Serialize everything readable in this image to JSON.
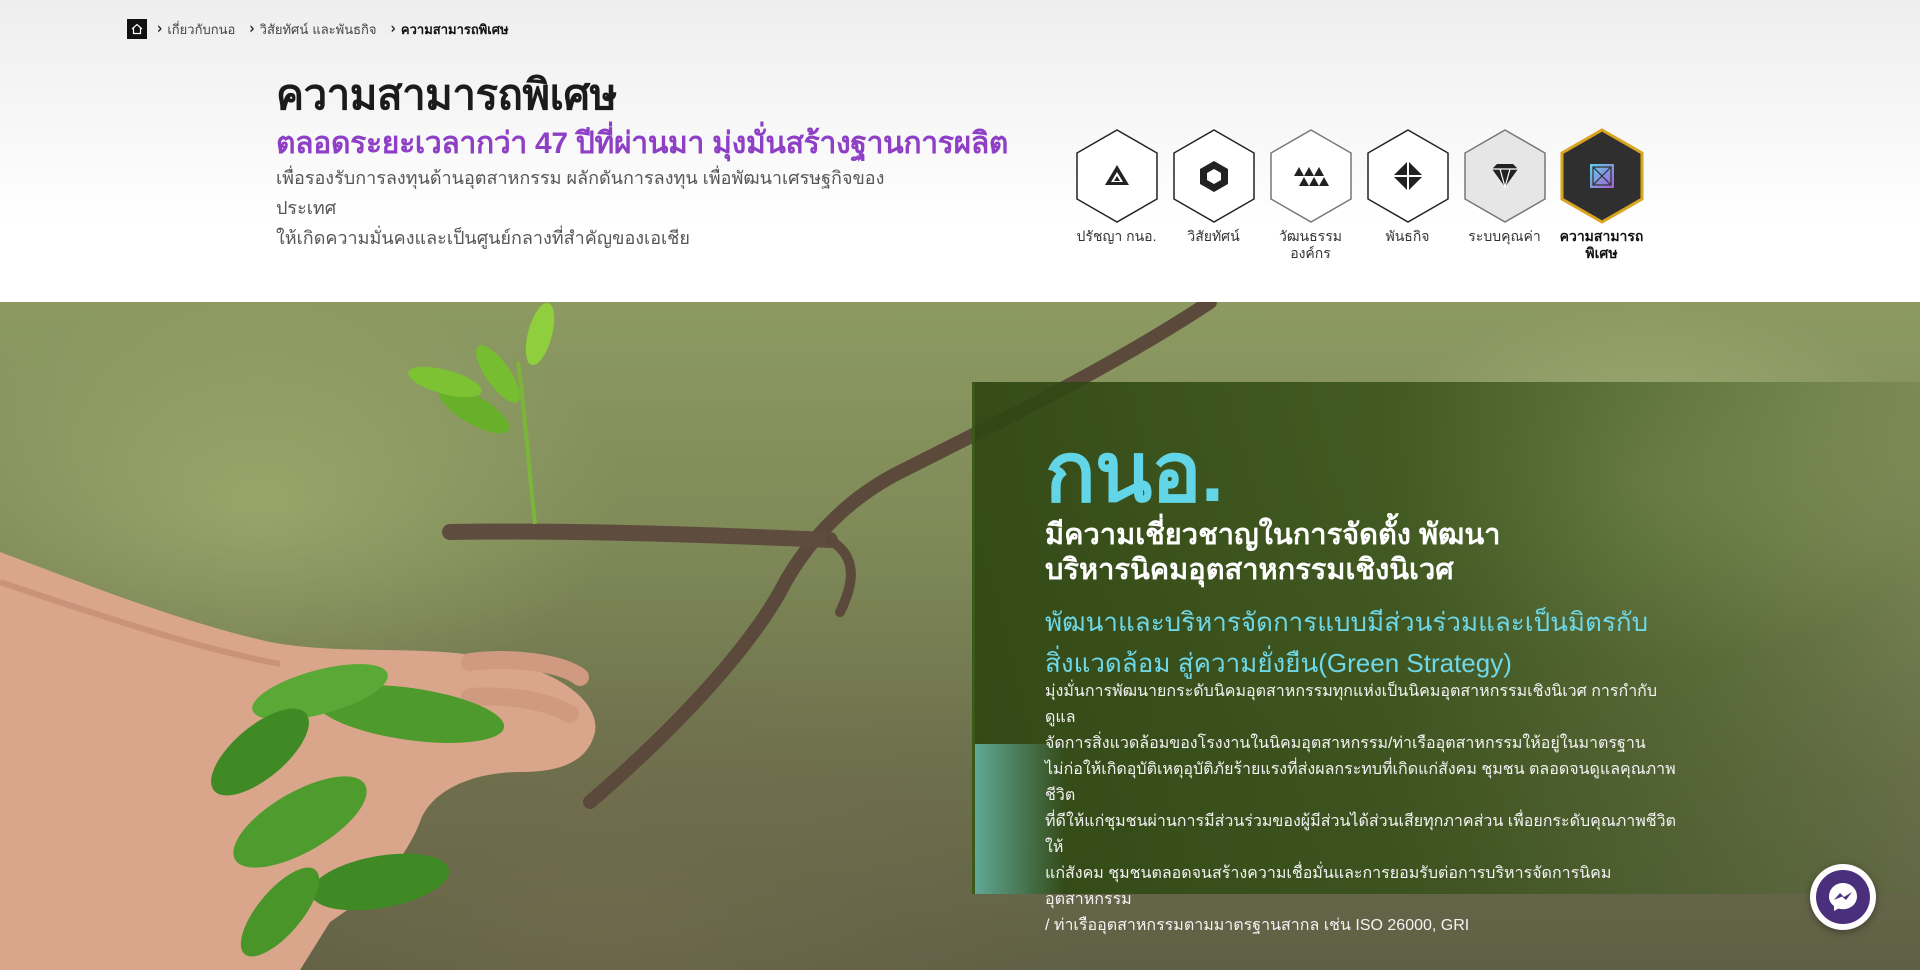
{
  "breadcrumb": {
    "home_icon": "home-icon",
    "items": [
      {
        "label": "เกี่ยวกับกนอ"
      },
      {
        "label": "วิสัยทัศน์ และพันธกิจ"
      },
      {
        "label": "ความสามารถพิเศษ"
      }
    ]
  },
  "header": {
    "title": "ความสามารถพิเศษ",
    "subtitle": "ตลอดระยะเวลากว่า 47 ปีที่ผ่านมา มุ่งมั่นสร้างฐานการผลิต",
    "desc_line1": "เพื่อรองรับการลงทุนด้านอุตสาหกรรม ผลักดันการลงทุน เพื่อพัฒนาเศรษฐกิจของประเทศ",
    "desc_line2": "ให้เกิดความมั่นคงและเป็นศูนย์กลางที่สำคัญของเอเชีย"
  },
  "hex_nav": [
    {
      "label": "ปรัชญา กนอ.",
      "icon": "triangles-icon",
      "active": false
    },
    {
      "label": "วิสัยทัศน์",
      "icon": "hexagon-ring-icon",
      "active": false
    },
    {
      "label": "วัฒนธรรมองค์กร",
      "icon": "mountains-icon",
      "active": false
    },
    {
      "label": "พันธกิจ",
      "icon": "diamond-quad-icon",
      "active": false
    },
    {
      "label": "ระบบคุณค่า",
      "icon": "gem-icon",
      "active": false
    },
    {
      "label": "ความสามารถพิเศษ",
      "label_line1": "ความสามารถ",
      "label_line2": "พิเศษ",
      "icon": "crossed-box-icon",
      "active": true
    }
  ],
  "hero": {
    "brand": "กนอ.",
    "lead_line1": "มีความเชี่ยวชาญในการจัดตั้ง พัฒนา",
    "lead_line2": "บริหารนิคมอุตสาหกรรมเชิงนิเวศ",
    "strategy_line1": "พัฒนาและบริหารจัดการแบบมีส่วนร่วมและเป็นมิตรกับ",
    "strategy_line2": "สิ่งแวดล้อม สู่ความยั่งยืน(Green Strategy)",
    "body_lines": [
      "มุ่งมั่นการพัฒนายกระดับนิคมอุตสาหกรรมทุกแห่งเป็นนิคมอุตสาหกรรมเชิงนิเวศ การกำกับดูแล",
      "จัดการสิ่งแวดล้อมของโรงงานในนิคมอุตสาหกรรม/ท่าเรืออุตสาหกรรมให้อยู่ในมาตรฐาน",
      "ไม่ก่อให้เกิดอุบัติเหตุอุบัติภัยร้ายแรงที่ส่งผลกระทบที่เกิดแก่สังคม ชุมชน ตลอดจนดูแลคุณภาพชีวิต",
      "ที่ดีให้แก่ชุมชนผ่านการมีส่วนร่วมของผู้มีส่วนได้ส่วนเสียทุกภาคส่วน เพื่อยกระดับคุณภาพชีวิตให้",
      "แก่สังคม ชุมชนตลอดจนสร้างความเชื่อมั่นและการยอมรับต่อการบริหารจัดการนิคมอุตสาหกรรม",
      "/ ท่าเรืออุตสาหกรรมตามมาตรฐานสากล เช่น ISO 26000, GRI"
    ]
  },
  "chat": {
    "icon": "messenger-icon"
  },
  "colors": {
    "accent_purple": "#8e3fc6",
    "accent_cyan": "#62d6e6",
    "active_hex_border": "#d9a520",
    "active_hex_fill": "#2f2f2f"
  }
}
